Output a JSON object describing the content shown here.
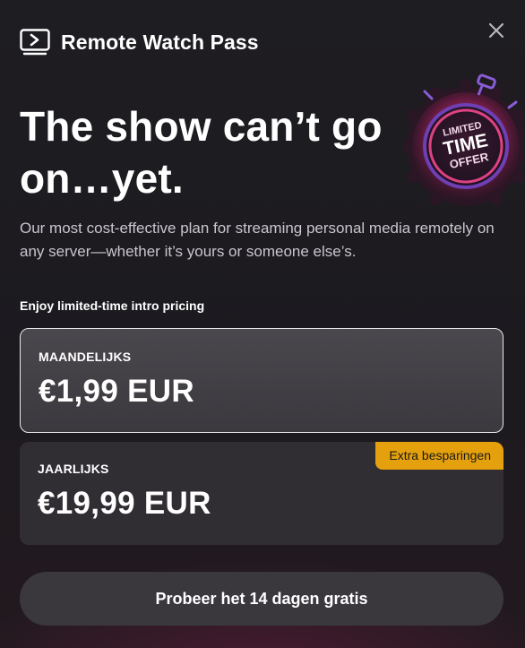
{
  "header": {
    "app_title": "Remote Watch Pass",
    "logo_icon": "tv-play-icon",
    "close_icon": "close-icon"
  },
  "badge": {
    "line1": "LIMITED",
    "line2": "TIME",
    "line3": "OFFER",
    "icon": "stopwatch-icon"
  },
  "main": {
    "headline_line1": "The show can’t go",
    "headline_line2": "on…yet.",
    "description": "Our most cost-effective plan for streaming personal media remotely on any server—whether it’s yours or someone else’s.",
    "intro_pricing": "Enjoy limited-time intro pricing"
  },
  "plans": [
    {
      "label": "MAANDELIJKS",
      "price": "€1,99 EUR",
      "selected": true
    },
    {
      "label": "JAARLIJKS",
      "price": "€19,99 EUR",
      "selected": false,
      "tag": "Extra besparingen"
    }
  ],
  "cta": {
    "label": "Probeer het 14 dagen gratis"
  },
  "colors": {
    "background": "#1c1b1f",
    "accent_gold": "#e5a00d",
    "selected_border": "#e8e8ea",
    "badge_pink": "#e0307a",
    "badge_purple": "#6f3fb5"
  }
}
